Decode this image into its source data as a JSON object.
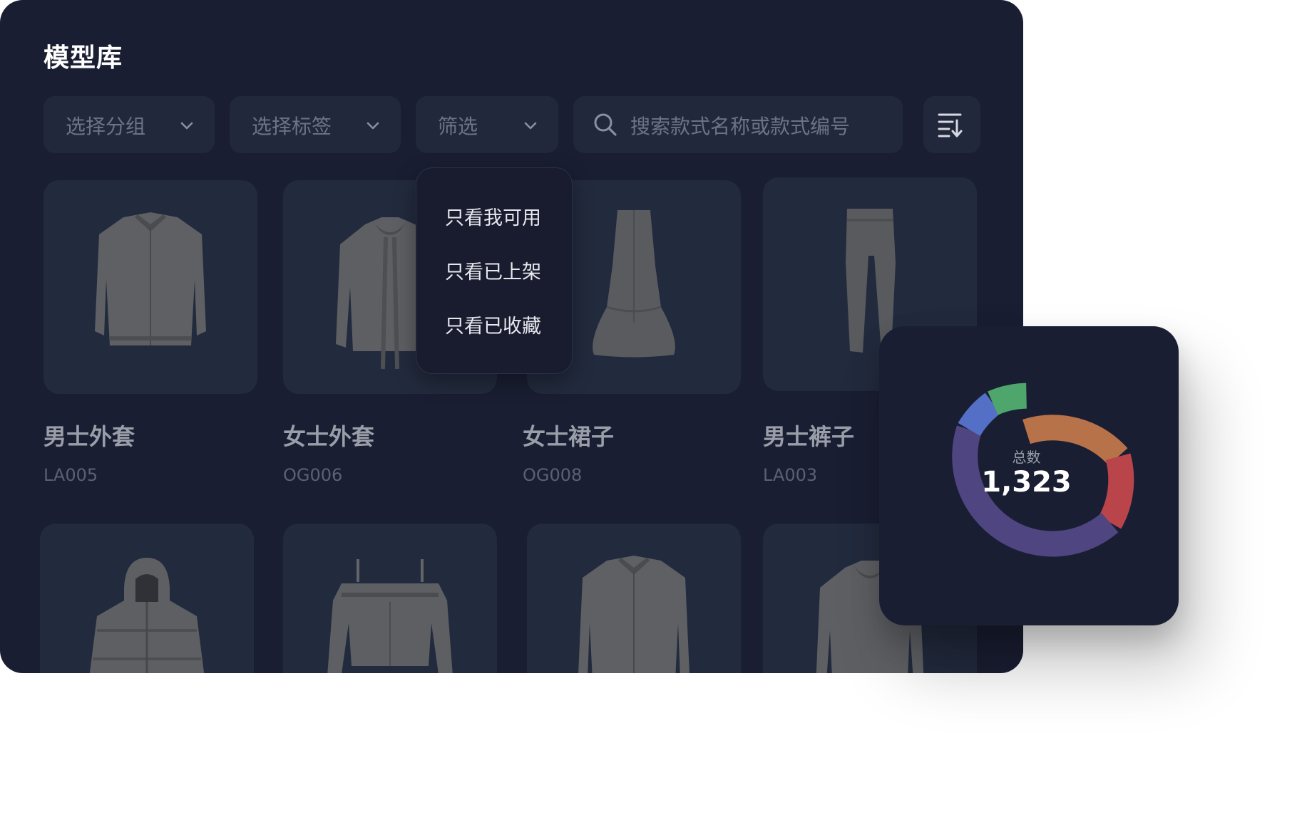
{
  "page_title": "模型库",
  "filters": {
    "group": "选择分组",
    "tag": "选择标签",
    "filter": "筛选",
    "search_placeholder": "搜索款式名称或款式编号"
  },
  "dropdown": {
    "options": [
      "只看我可用",
      "只看已上架",
      "只看已收藏"
    ]
  },
  "models": [
    {
      "name": "男士外套",
      "code": "LA005",
      "garment": "jacket-icon"
    },
    {
      "name": "女士外套",
      "code": "OG006",
      "garment": "hoodie-icon"
    },
    {
      "name": "女士裙子",
      "code": "OG008",
      "garment": "skirt-icon"
    },
    {
      "name": "男士裤子",
      "code": "LA003",
      "garment": "pants-icon"
    },
    {
      "name": "",
      "code": "",
      "garment": "puffer-jacket-icon"
    },
    {
      "name": "",
      "code": "",
      "garment": "off-shoulder-top-icon"
    },
    {
      "name": "",
      "code": "",
      "garment": "jacket-icon"
    },
    {
      "name": "",
      "code": "",
      "garment": "hoodie-icon"
    }
  ],
  "stats": {
    "caption": "总数",
    "total": "1,323"
  },
  "colors": {
    "panel": "#1a1e32",
    "control": "#22283c",
    "card": "#222a3d",
    "ring": [
      "#b8724a",
      "#b9454b",
      "#4e4581",
      "#5470c6",
      "#4ea66c"
    ]
  }
}
